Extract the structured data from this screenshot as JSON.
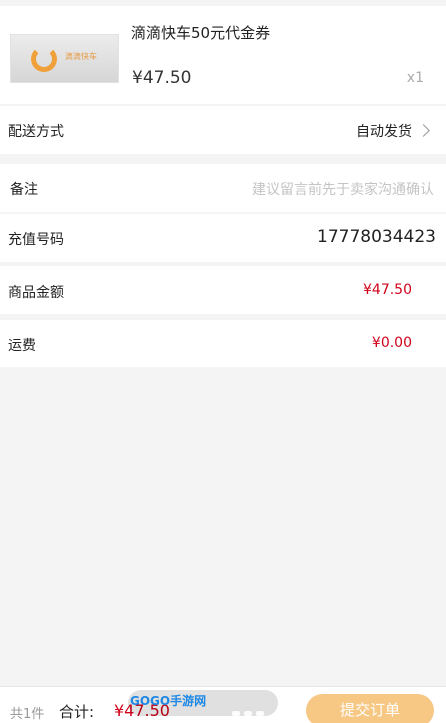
{
  "product": {
    "title": "滴滴快车50元代金券",
    "price": "¥47.50",
    "quantity": "x1",
    "thumb_text": "滴滴快车"
  },
  "delivery": {
    "label": "配送方式",
    "value": "自动发货"
  },
  "remark": {
    "label": "备注",
    "placeholder": "建议留言前先于卖家沟通确认"
  },
  "recharge": {
    "label": "充值号码",
    "value": "17778034423"
  },
  "goods_amount": {
    "label": "商品金额",
    "value": "¥47.50"
  },
  "shipping": {
    "label": "运费",
    "value": "¥0.00"
  },
  "footer": {
    "count": "共1件",
    "total_label": "合计:",
    "total_value": "¥47.50",
    "submit_label": "提交订单"
  },
  "watermark": {
    "text": "GOGO手游网"
  },
  "colors": {
    "accent_red": "#d0021b",
    "submit_bg": "#f7c784",
    "logo_orange": "#f0a03a"
  }
}
